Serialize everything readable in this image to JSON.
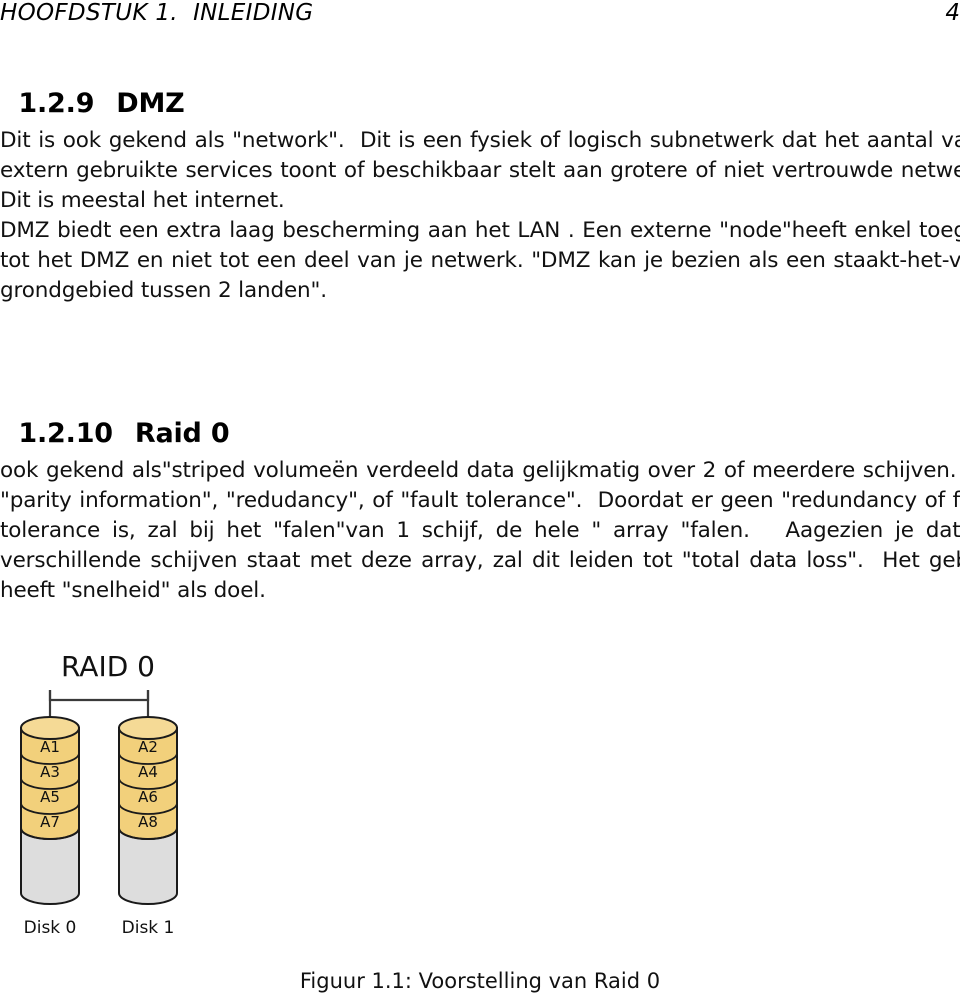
{
  "header": {
    "title": "HOOFDSTUK 1.  INLEIDING",
    "page_number": "4"
  },
  "sections": [
    {
      "number": "1.2.9",
      "title": "DMZ"
    },
    {
      "number": "1.2.10",
      "title": "Raid 0"
    }
  ],
  "paragraphs": {
    "dmz_intro": {
      "lines": [
        "Dit is ook gekend als \"network\".  Dit is een fysiek of logisch subnetwerk dat het aantal van",
        "extern gebruikte services toont of beschikbaar stelt aan grotere of niet vertrouwde netwerken.",
        "Dit is meestal het internet."
      ]
    },
    "dmz_detail": {
      "lines": [
        "DMZ biedt een extra laag bescherming aan het LAN . Een externe \"node\"heeft enkel toegang",
        "tot het DMZ en niet tot een deel van je netwerk. \"DMZ kan je bezien als een staakt-het-vuren",
        "grondgebied tussen 2 landen\"."
      ]
    },
    "raid_body": {
      "lines": [
        "ook gekend als\"striped volumeën verdeeld data gelijkmatig over 2 of meerdere schijven. Zonder",
        "\"parity information\", \"redudancy\", of \"fault tolerance\".  Doordat er geen \"redundancy of fault",
        "tolerance is, zal bij het \"falen\"van 1 schijf, de hele \" array \"falen.   Aagezien je data over",
        "verschillende schijven staat met deze array, zal dit leiden tot \"total data loss\".  Het gebruik",
        "heeft \"snelheid\" als doel."
      ]
    }
  },
  "figure": {
    "caption": "Figuur 1.1: Voorstelling van Raid 0",
    "diagram_title": "RAID 0",
    "disks": [
      {
        "label": "Disk 0",
        "blocks": [
          "A1",
          "A3",
          "A5",
          "A7"
        ]
      },
      {
        "label": "Disk 1",
        "blocks": [
          "A2",
          "A4",
          "A6",
          "A8"
        ]
      }
    ],
    "colors": {
      "stripe_fill": "#F2D07B",
      "stripe_top": "#F5DA96",
      "empty_fill": "#DDDDDD",
      "outline": "#1A1A1A"
    }
  }
}
